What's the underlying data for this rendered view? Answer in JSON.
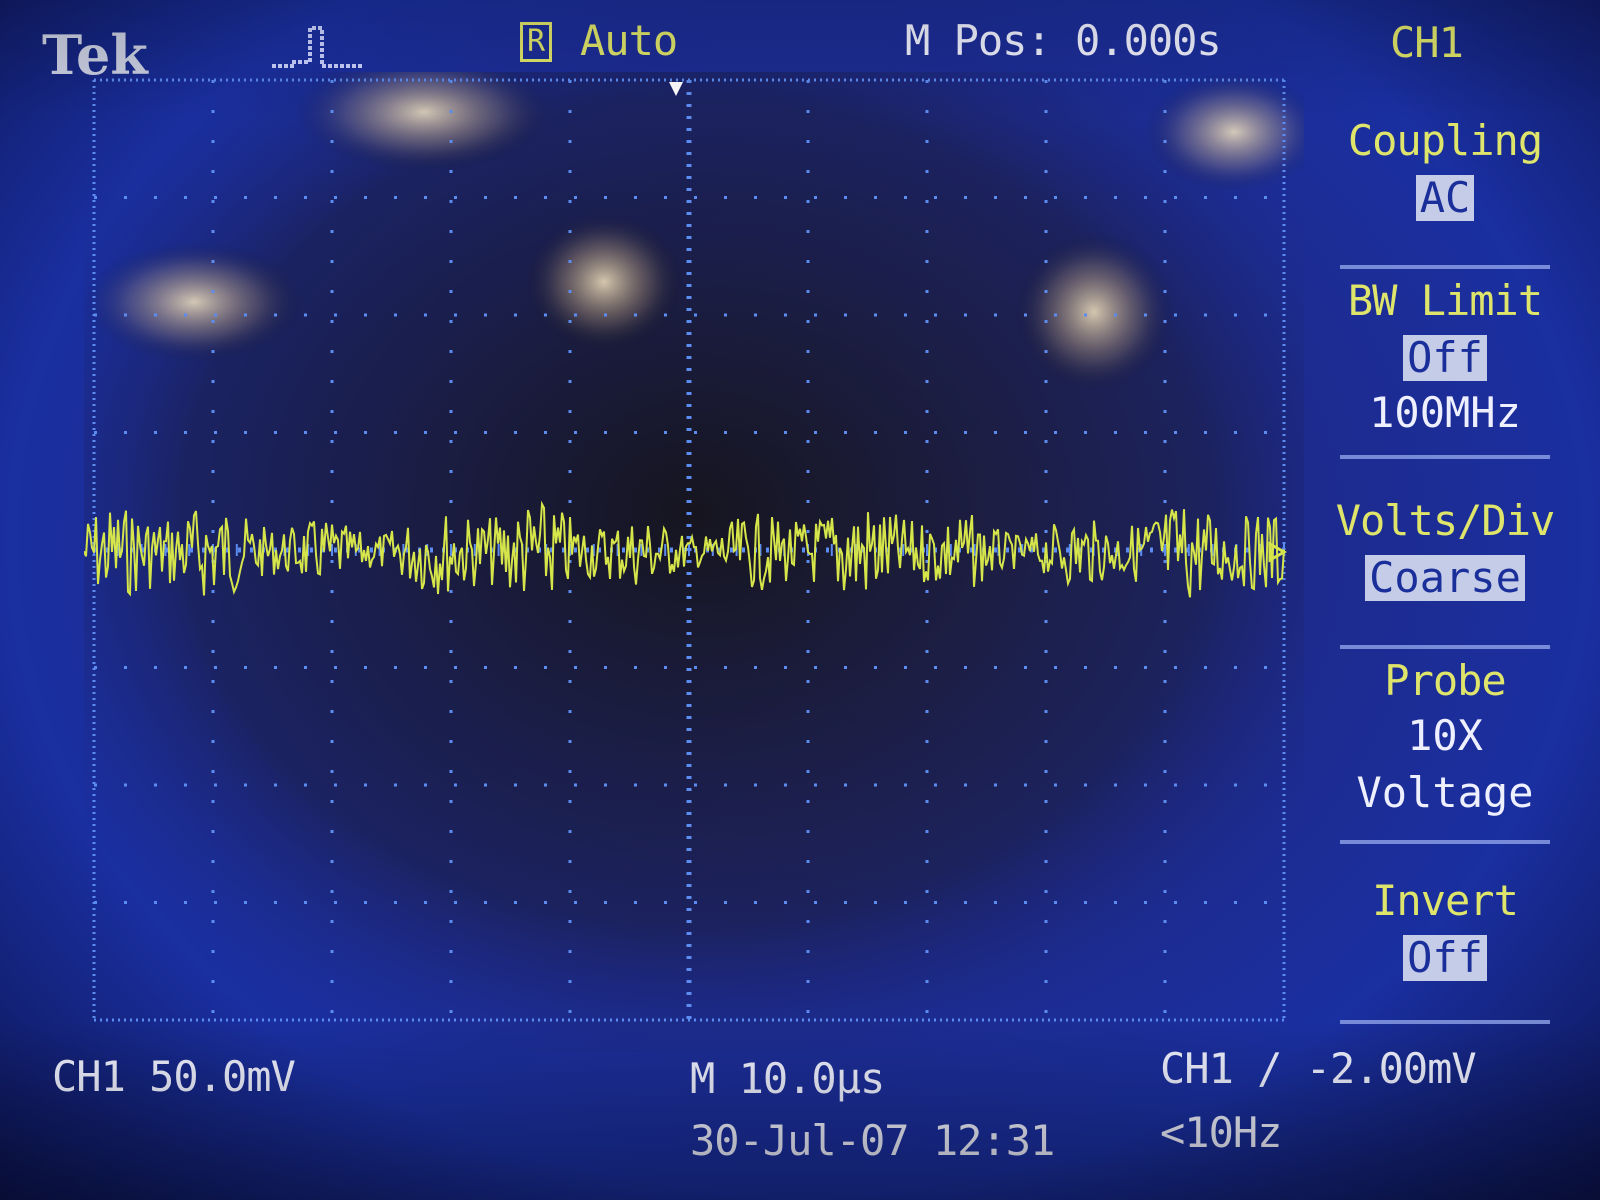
{
  "header": {
    "brand": "Tek",
    "trigger_icon": "pulse-waveform-icon",
    "run_icon_letter": "R",
    "run_mode": "Auto",
    "m_pos": "M Pos: 0.000s"
  },
  "side_menu": {
    "title": "CH1",
    "items": [
      {
        "label": "Coupling",
        "values": [
          "AC"
        ],
        "selected": true
      },
      {
        "label": "BW Limit",
        "values": [
          "Off",
          "100MHz"
        ],
        "selected": true
      },
      {
        "label": "Volts/Div",
        "values": [
          "Coarse"
        ],
        "selected": true
      },
      {
        "label": "Probe",
        "values": [
          "10X",
          "Voltage"
        ],
        "selected": false
      },
      {
        "label": "Invert",
        "values": [
          "Off"
        ],
        "selected": true
      }
    ]
  },
  "footer": {
    "channel_scale": "CH1  50.0mV",
    "timebase": "M 10.0µs",
    "date_time": "30-Jul-07 12:31",
    "trigger": "CH1 ∕ -2.00mV",
    "trigger_freq": "<10Hz"
  },
  "display": {
    "channel_marker": "1",
    "trace_color": "#d6e64a",
    "grid_color": "#5d8cf0",
    "background_color": "#1c2a90"
  }
}
